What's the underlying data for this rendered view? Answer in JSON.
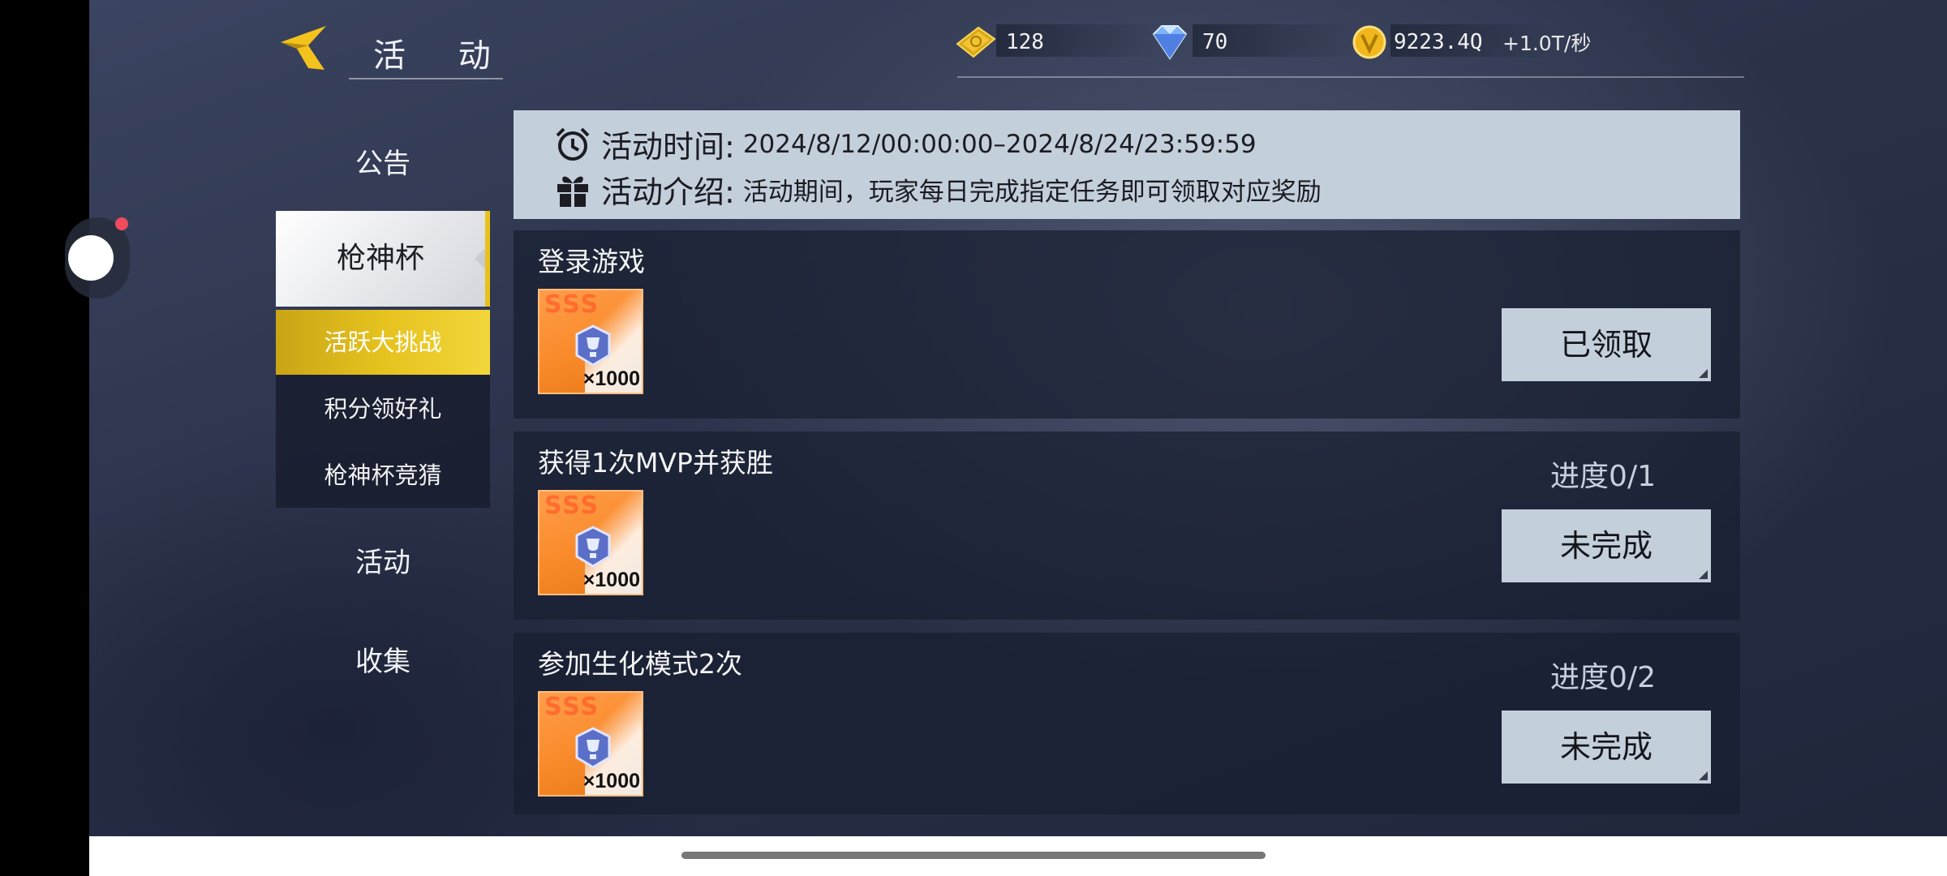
{
  "header": {
    "title": "活 动",
    "resources": [
      {
        "name": "gold-voucher",
        "value": "128"
      },
      {
        "name": "diamond",
        "value": "70"
      },
      {
        "name": "coin",
        "value": "9223.4Q"
      }
    ],
    "coin_rate": "+1.0T/秒"
  },
  "nav": {
    "items": [
      "公告",
      "枪神杯",
      "活动",
      "收集"
    ],
    "active": "枪神杯",
    "sub_items": [
      "活跃大挑战",
      "积分领好礼",
      "枪神杯竞猜"
    ],
    "active_sub": "活跃大挑战"
  },
  "info": {
    "time_label": "活动时间:",
    "time_value": "2024/8/12/00:00:00–2024/8/24/23:59:59",
    "intro_label": "活动介绍:",
    "intro_value": "活动期间，玩家每日完成指定任务即可领取对应奖励"
  },
  "tasks": [
    {
      "title": "登录游戏",
      "progress": "",
      "reward_tier": "SSS",
      "reward_qty": "×1000",
      "button": "已领取"
    },
    {
      "title": "获得1次MVP并获胜",
      "progress": "进度0/1",
      "reward_tier": "SSS",
      "reward_qty": "×1000",
      "button": "未完成"
    },
    {
      "title": "参加生化模式2次",
      "progress": "进度0/2",
      "reward_tier": "SSS",
      "reward_qty": "×1000",
      "button": "未完成"
    }
  ],
  "colors": {
    "accent_yellow": "#e6c21f",
    "panel_light": "#c4cfdc",
    "reward_orange": "#f98a2a"
  }
}
